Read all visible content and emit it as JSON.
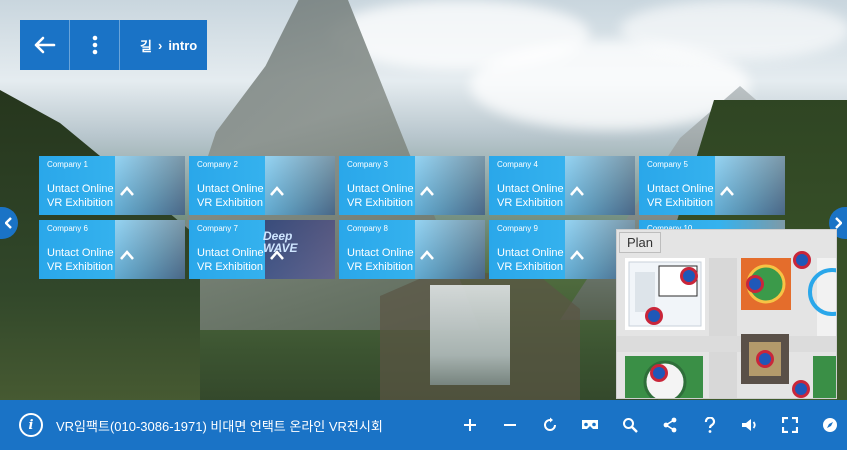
{
  "topbar": {
    "back_icon": "arrow-left-icon",
    "menu_icon": "more-vertical-icon",
    "breadcrumb": {
      "root": "길",
      "separator": "›",
      "current": "intro"
    }
  },
  "tiles": [
    {
      "company": "Company 1",
      "line1": "Untact Online",
      "line2": "VR Exhibition"
    },
    {
      "company": "Company 2",
      "line1": "Untact Online",
      "line2": "VR Exhibition"
    },
    {
      "company": "Company 3",
      "line1": "Untact Online",
      "line2": "VR Exhibition"
    },
    {
      "company": "Company 4",
      "line1": "Untact Online",
      "line2": "VR Exhibition"
    },
    {
      "company": "Company 5",
      "line1": "Untact Online",
      "line2": "VR Exhibition"
    },
    {
      "company": "Company 6",
      "line1": "Untact Online",
      "line2": "VR Exhibition"
    },
    {
      "company": "Company 7",
      "line1": "Untact Online",
      "line2": "VR Exhibition"
    },
    {
      "company": "Company 8",
      "line1": "Untact Online",
      "line2": "VR Exhibition"
    },
    {
      "company": "Company 9",
      "line1": "Untact Online",
      "line2": "VR Exhibition"
    },
    {
      "company": "Company 10",
      "line1": "",
      "line2": ""
    }
  ],
  "tile_overlay_texts": {
    "tile7_logo": "Deep WAVE"
  },
  "plan": {
    "label": "Plan"
  },
  "bottombar": {
    "info_glyph": "i",
    "title": "VR임팩트(010-3086-1971) 비대면 언택트 온라인 VR전시회",
    "tools": [
      "zoom-in-icon",
      "zoom-out-icon",
      "autorotate-icon",
      "vr-headset-icon",
      "search-icon",
      "share-icon",
      "help-icon",
      "sound-icon",
      "fullscreen-icon",
      "compass-icon"
    ]
  },
  "colors": {
    "accent": "#1a73c6",
    "tile": "#2aa7ea",
    "marker_fill": "#1f58b8",
    "marker_ring": "#c9263a"
  }
}
